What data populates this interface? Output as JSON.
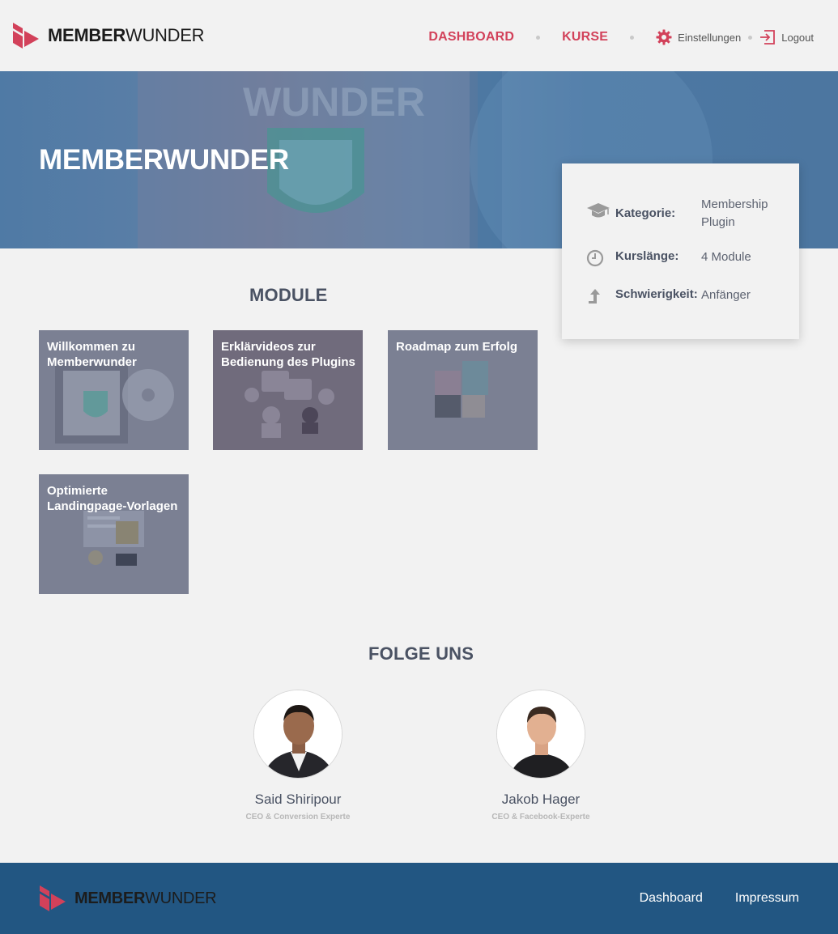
{
  "brand": {
    "name_bold": "MEMBER",
    "name_light": "WUNDER",
    "accent": "#d2415a"
  },
  "nav": {
    "dashboard": "DASHBOARD",
    "courses": "KURSE",
    "settings": "Einstellungen",
    "logout": "Logout"
  },
  "hero": {
    "title": "MEMBERWUNDER"
  },
  "info": {
    "category_label": "Kategorie:",
    "category_value": "Membership Plugin",
    "length_label": "Kurslänge:",
    "length_value": "4 Module",
    "difficulty_label": "Schwierigkeit:",
    "difficulty_value": "Anfänger"
  },
  "modules": {
    "title": "MODULE",
    "items": [
      {
        "title": "Willkommen zu Memberwunder"
      },
      {
        "title": "Erklärvideos zur Bedienung des Plugins"
      },
      {
        "title": "Roadmap zum Erfolg"
      },
      {
        "title": "Optimierte Landingpage-Vorlagen"
      }
    ]
  },
  "team": {
    "title": "FOLGE UNS",
    "people": [
      {
        "name": "Said Shiripour",
        "role": "CEO & Conversion Experte"
      },
      {
        "name": "Jakob Hager",
        "role": "CEO & Facebook-Experte"
      }
    ]
  },
  "footer": {
    "dashboard": "Dashboard",
    "impressum": "Impressum",
    "background": "#225682"
  }
}
